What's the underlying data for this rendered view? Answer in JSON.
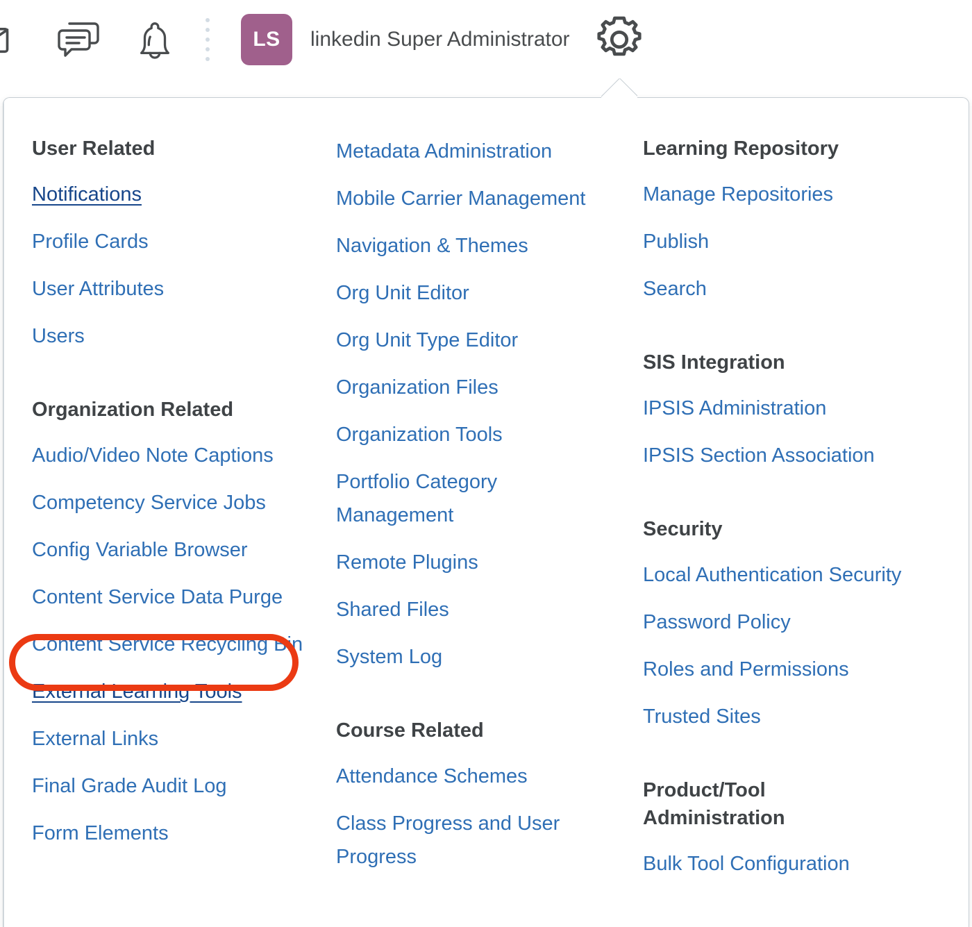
{
  "topbar": {
    "icons": [
      {
        "name": "mail-icon",
        "label": "Email"
      },
      {
        "name": "chat-icon",
        "label": "Messages"
      },
      {
        "name": "bell-icon",
        "label": "Notifications"
      }
    ],
    "avatar_initials": "LS",
    "user_name": "linkedin Super Administrator",
    "gear_label": "Admin Tools"
  },
  "colors": {
    "link": "#2f6fb5",
    "link_active": "#17468a",
    "heading": "#3f4346",
    "avatar_bg": "#a0608c",
    "highlight": "#eb3a13",
    "icon": "#494c4e"
  },
  "menu": {
    "columns": [
      {
        "groups": [
          {
            "title": "User Related",
            "items": [
              {
                "label": "Notifications",
                "active": true
              },
              {
                "label": "Profile Cards",
                "active": false
              },
              {
                "label": "User Attributes",
                "active": false
              },
              {
                "label": "Users",
                "active": false
              }
            ]
          },
          {
            "title": "Organization Related",
            "items": [
              {
                "label": "Audio/Video Note Captions",
                "active": false
              },
              {
                "label": "Competency Service Jobs",
                "active": false
              },
              {
                "label": "Config Variable Browser",
                "active": false
              },
              {
                "label": "Content Service Data Purge",
                "active": false
              },
              {
                "label": "Content Service Recycling Bin",
                "active": false
              },
              {
                "label": "External Learning Tools",
                "active": true
              },
              {
                "label": "External Links",
                "active": false
              },
              {
                "label": "Final Grade Audit Log",
                "active": false
              },
              {
                "label": "Form Elements",
                "active": false
              }
            ]
          }
        ]
      },
      {
        "groups": [
          {
            "title": "",
            "items": [
              {
                "label": "Metadata Administration",
                "active": false
              },
              {
                "label": "Mobile Carrier Management",
                "active": false
              },
              {
                "label": "Navigation & Themes",
                "active": false
              },
              {
                "label": "Org Unit Editor",
                "active": false
              },
              {
                "label": "Org Unit Type Editor",
                "active": false
              },
              {
                "label": "Organization Files",
                "active": false
              },
              {
                "label": "Organization Tools",
                "active": false
              },
              {
                "label": "Portfolio Category Management",
                "active": false
              },
              {
                "label": "Remote Plugins",
                "active": false
              },
              {
                "label": "Shared Files",
                "active": false
              },
              {
                "label": "System Log",
                "active": false
              }
            ]
          },
          {
            "title": "Course Related",
            "items": [
              {
                "label": "Attendance Schemes",
                "active": false
              },
              {
                "label": "Class Progress and User Progress",
                "active": false
              }
            ]
          }
        ]
      },
      {
        "groups": [
          {
            "title": "Learning Repository",
            "items": [
              {
                "label": "Manage Repositories",
                "active": false
              },
              {
                "label": "Publish",
                "active": false
              },
              {
                "label": "Search",
                "active": false
              }
            ]
          },
          {
            "title": "SIS Integration",
            "items": [
              {
                "label": "IPSIS Administration",
                "active": false
              },
              {
                "label": "IPSIS Section Association",
                "active": false
              }
            ]
          },
          {
            "title": "Security",
            "items": [
              {
                "label": "Local Authentication Security",
                "active": false
              },
              {
                "label": "Password Policy",
                "active": false
              },
              {
                "label": "Roles and Permissions",
                "active": false
              },
              {
                "label": "Trusted Sites",
                "active": false
              }
            ]
          },
          {
            "title": "Product/Tool Administration",
            "items": [
              {
                "label": "Bulk Tool Configuration",
                "active": false
              }
            ]
          }
        ]
      }
    ]
  }
}
